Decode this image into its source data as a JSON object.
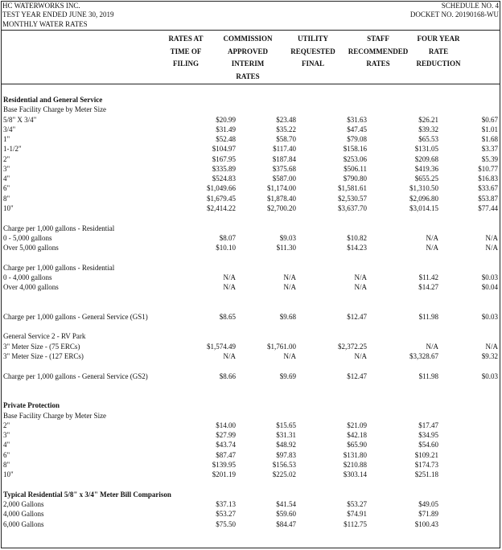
{
  "header": {
    "company": "HC WATERWORKS INC.",
    "period": "TEST YEAR ENDED JUNE 30, 2019",
    "subject": "MONTHLY WATER RATES",
    "schedule": "SCHEDULE NO. 4",
    "docket": "DOCKET NO. 20190168-WU"
  },
  "columns": [
    [
      "",
      "RATES AT",
      "TIME OF",
      "FILING"
    ],
    [
      "COMMISSION",
      "APPROVED",
      "INTERIM",
      "RATES"
    ],
    [
      "",
      "UTILITY",
      "REQUESTED",
      "FINAL"
    ],
    [
      "",
      "STAFF",
      "RECOMMENDED",
      "RATES"
    ],
    [
      "",
      "FOUR YEAR",
      "RATE",
      "REDUCTION"
    ]
  ],
  "rows": [
    {
      "label": "Residential and General Service",
      "vals": [
        "",
        "",
        "",
        "",
        ""
      ],
      "title": true
    },
    {
      "label": "Base Facility Charge by Meter Size",
      "vals": [
        "",
        "",
        "",
        "",
        ""
      ]
    },
    {
      "label": "5/8\" X 3/4\"",
      "vals": [
        "$20.99",
        "$23.48",
        "$31.63",
        "$26.21",
        "$0.67"
      ]
    },
    {
      "label": "3/4\"",
      "vals": [
        "$31.49",
        "$35.22",
        "$47.45",
        "$39.32",
        "$1.01"
      ]
    },
    {
      "label": "1\"",
      "vals": [
        "$52.48",
        "$58.70",
        "$79.08",
        "$65.53",
        "$1.68"
      ]
    },
    {
      "label": "1-1/2\"",
      "vals": [
        "$104.97",
        "$117.40",
        "$158.16",
        "$131.05",
        "$3.37"
      ]
    },
    {
      "label": "2\"",
      "vals": [
        "$167.95",
        "$187.84",
        "$253.06",
        "$209.68",
        "$5.39"
      ]
    },
    {
      "label": "3\"",
      "vals": [
        "$335.89",
        "$375.68",
        "$506.11",
        "$419.36",
        "$10.77"
      ]
    },
    {
      "label": "4\"",
      "vals": [
        "$524.83",
        "$587.00",
        "$790.80",
        "$655.25",
        "$16.83"
      ]
    },
    {
      "label": "6\"",
      "vals": [
        "$1,049.66",
        "$1,174.00",
        "$1,581.61",
        "$1,310.50",
        "$33.67"
      ]
    },
    {
      "label": "8\"",
      "vals": [
        "$1,679.45",
        "$1,878.40",
        "$2,530.57",
        "$2,096.80",
        "$53.87"
      ]
    },
    {
      "label": "10\"",
      "vals": [
        "$2,414.22",
        "$2,700.20",
        "$3,637.70",
        "$3,014.15",
        "$77.44"
      ]
    },
    {
      "label": "",
      "vals": [
        "",
        "",
        "",
        "",
        ""
      ]
    },
    {
      "label": "Charge per 1,000 gallons - Residential",
      "vals": [
        "",
        "",
        "",
        "",
        ""
      ]
    },
    {
      "label": "0 - 5,000 gallons",
      "vals": [
        "$8.07",
        "$9.03",
        "$10.82",
        "N/A",
        "N/A"
      ]
    },
    {
      "label": "Over 5,000 gallons",
      "vals": [
        "$10.10",
        "$11.30",
        "$14.23",
        "N/A",
        "N/A"
      ]
    },
    {
      "label": "",
      "vals": [
        "",
        "",
        "",
        "",
        ""
      ]
    },
    {
      "label": "Charge per 1,000 gallons - Residential",
      "vals": [
        "",
        "",
        "",
        "",
        ""
      ]
    },
    {
      "label": "0 - 4,000 gallons",
      "vals": [
        "N/A",
        "N/A",
        "N/A",
        "$11.42",
        "$0.03"
      ]
    },
    {
      "label": "Over 4,000 gallons",
      "vals": [
        "N/A",
        "N/A",
        "N/A",
        "$14.27",
        "$0.04"
      ]
    },
    {
      "label": "",
      "vals": [
        "",
        "",
        "",
        "",
        ""
      ]
    },
    {
      "label": "",
      "vals": [
        "",
        "",
        "",
        "",
        ""
      ]
    },
    {
      "label": "Charge per 1,000 gallons - General Service (GS1)",
      "vals": [
        "$8.65",
        "$9.68",
        "$12.47",
        "$11.98",
        "$0.03"
      ]
    },
    {
      "label": "",
      "vals": [
        "",
        "",
        "",
        "",
        ""
      ]
    },
    {
      "label": "General Service 2 - RV Park",
      "vals": [
        "",
        "",
        "",
        "",
        ""
      ]
    },
    {
      "label": "3\" Meter Size - (75 ERCs)",
      "vals": [
        "$1,574.49",
        "$1,761.00",
        "$2,372.25",
        "N/A",
        "N/A"
      ]
    },
    {
      "label": "3\" Meter Size - (127 ERCs)",
      "vals": [
        "N/A",
        "N/A",
        "N/A",
        "$3,328.67",
        "$9.32"
      ]
    },
    {
      "label": "",
      "vals": [
        "",
        "",
        "",
        "",
        ""
      ]
    },
    {
      "label": "Charge per 1,000 gallons - General Service (GS2)",
      "vals": [
        "$8.66",
        "$9.69",
        "$12.47",
        "$11.98",
        "$0.03"
      ]
    },
    {
      "label": "",
      "vals": [
        "",
        "",
        "",
        "",
        ""
      ]
    },
    {
      "label": "",
      "vals": [
        "",
        "",
        "",
        "",
        ""
      ]
    },
    {
      "label": "Private Protection",
      "vals": [
        "",
        "",
        "",
        "",
        ""
      ],
      "title": true
    },
    {
      "label": "Base Facility Charge by Meter Size",
      "vals": [
        "",
        "",
        "",
        "",
        ""
      ]
    },
    {
      "label": "2\"",
      "vals": [
        "$14.00",
        "$15.65",
        "$21.09",
        "$17.47",
        ""
      ]
    },
    {
      "label": "3\"",
      "vals": [
        "$27.99",
        "$31.31",
        "$42.18",
        "$34.95",
        ""
      ]
    },
    {
      "label": "4\"",
      "vals": [
        "$43.74",
        "$48.92",
        "$65.90",
        "$54.60",
        ""
      ]
    },
    {
      "label": "6\"",
      "vals": [
        "$87.47",
        "$97.83",
        "$131.80",
        "$109.21",
        ""
      ]
    },
    {
      "label": "8\"",
      "vals": [
        "$139.95",
        "$156.53",
        "$210.88",
        "$174.73",
        ""
      ]
    },
    {
      "label": "10\"",
      "vals": [
        "$201.19",
        "$225.02",
        "$303.14",
        "$251.18",
        ""
      ]
    },
    {
      "label": "",
      "vals": [
        "",
        "",
        "",
        "",
        ""
      ]
    },
    {
      "label": "Typical Residential 5/8\" x 3/4\" Meter Bill Comparison",
      "vals": [
        "",
        "",
        "",
        "",
        ""
      ],
      "title": true
    },
    {
      "label": "2,000 Gallons",
      "vals": [
        "$37.13",
        "$41.54",
        "$53.27",
        "$49.05",
        ""
      ]
    },
    {
      "label": "4,000 Gallons",
      "vals": [
        "$53.27",
        "$59.60",
        "$74.91",
        "$71.89",
        ""
      ]
    },
    {
      "label": "6,000 Gallons",
      "vals": [
        "$75.50",
        "$84.47",
        "$112.75",
        "$100.43",
        ""
      ]
    }
  ]
}
